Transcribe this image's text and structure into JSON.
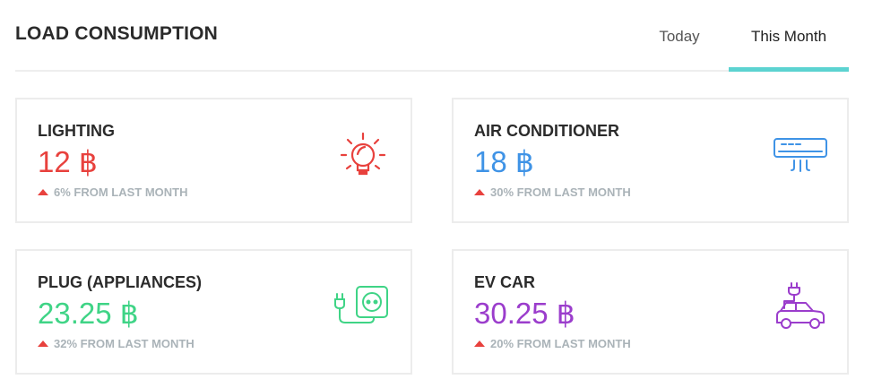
{
  "header": {
    "title": "LOAD CONSUMPTION",
    "tabs": [
      {
        "label": "Today"
      },
      {
        "label": "This Month"
      }
    ],
    "active_tab": "This Month",
    "accent_color": "#5cd3d1"
  },
  "cards": [
    {
      "label": "LIGHTING",
      "value": "12 ฿",
      "trend": "6% FROM LAST MONTH",
      "color": "#e8413d",
      "icon": "light-bulb-icon"
    },
    {
      "label": "AIR CONDITIONER",
      "value": "18 ฿",
      "trend": "30% FROM LAST MONTH",
      "color": "#3f93e6",
      "icon": "air-conditioner-icon"
    },
    {
      "label": "PLUG (APPLIANCES)",
      "value": "23.25 ฿",
      "trend": "32% FROM LAST MONTH",
      "color": "#3fd486",
      "icon": "plug-outlet-icon"
    },
    {
      "label": "EV CAR",
      "value": "30.25 ฿",
      "trend": "20% FROM LAST MONTH",
      "color": "#9b3dcc",
      "icon": "ev-car-icon"
    }
  ],
  "trend_arrow_color": "#e8413d"
}
